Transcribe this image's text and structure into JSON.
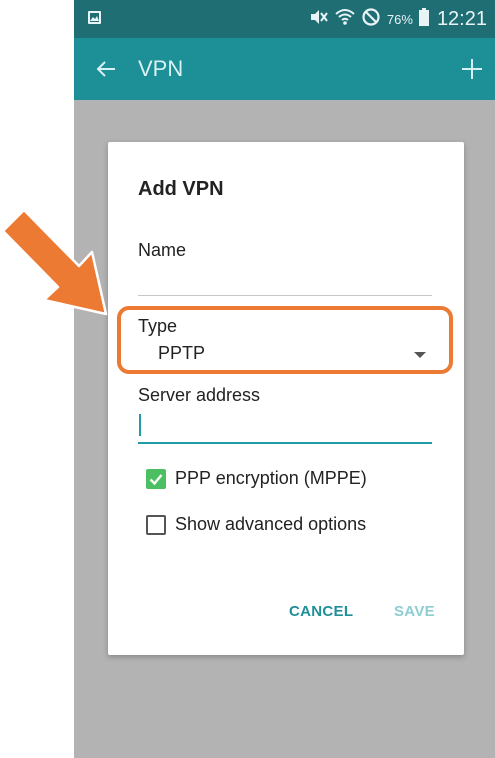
{
  "status_bar": {
    "battery_text": "76%",
    "time": "12:21",
    "icons": [
      "gallery-icon",
      "mute-icon",
      "wifi-icon",
      "blocked-icon",
      "battery-icon"
    ]
  },
  "app_bar": {
    "title": "VPN",
    "back_icon": "arrow-left-icon",
    "add_icon": "plus-icon"
  },
  "dialog": {
    "title": "Add VPN",
    "name_label": "Name",
    "name_value": "",
    "type_label": "Type",
    "type_value": "PPTP",
    "server_label": "Server address",
    "server_value": "",
    "checkboxes": [
      {
        "label": "PPP encryption (MPPE)",
        "checked": true
      },
      {
        "label": "Show advanced options",
        "checked": false
      }
    ],
    "cancel_label": "CANCEL",
    "save_label": "SAVE"
  },
  "annotation": {
    "highlight_color": "#ec7a32",
    "target": "Type"
  },
  "colors": {
    "status_bar": "#1f6e74",
    "app_bar": "#1d8f96",
    "accent": "#1f9ca5",
    "checkbox_checked": "#4cbf63",
    "scrim": "#b3b3b3"
  }
}
